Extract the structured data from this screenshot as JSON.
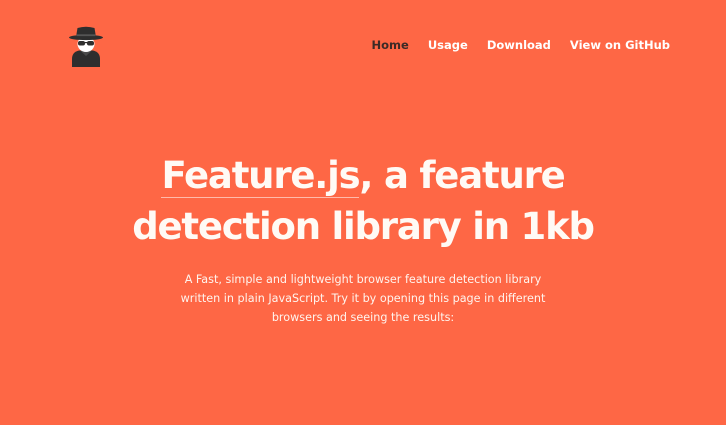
{
  "header": {
    "logo_icon": "spy-incognito-icon",
    "nav": [
      {
        "label": "Home",
        "active": true
      },
      {
        "label": "Usage",
        "active": false
      },
      {
        "label": "Download",
        "active": false
      },
      {
        "label": "View on GitHub",
        "active": false
      }
    ]
  },
  "hero": {
    "title_link": "Feature.js",
    "title_rest_line1": ", a feature",
    "title_line2": "detection library in 1kb",
    "description": "A Fast, simple and lightweight browser feature detection library written in plain JavaScript. Try it by opening this page in different browsers and seeing the results:"
  },
  "colors": {
    "background": "#FE6745",
    "nav_active": "#3d2a26",
    "text": "#ffffff"
  }
}
